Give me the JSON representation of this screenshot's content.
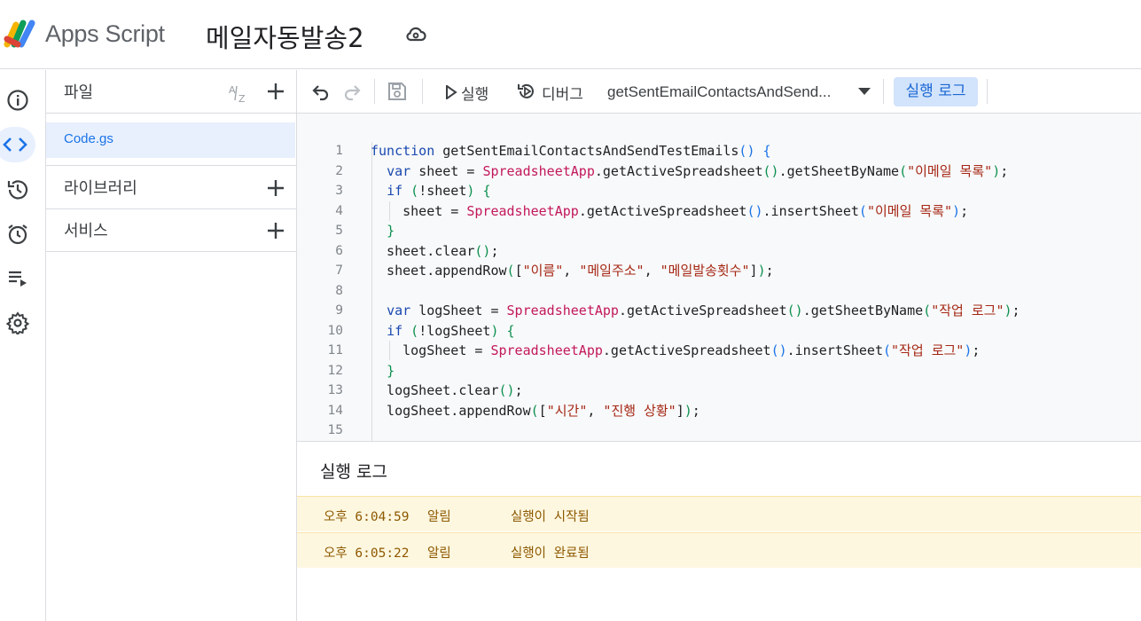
{
  "header": {
    "app_name": "Apps Script",
    "project_title": "메일자동발송2"
  },
  "rail": {
    "icons": [
      "info-icon",
      "code-icon",
      "history-icon",
      "alarm-icon",
      "executions-icon",
      "settings-icon"
    ],
    "active": "code-icon"
  },
  "files_panel": {
    "title": "파일",
    "sort_icon": "sort-az-icon",
    "files": [
      "Code.gs"
    ],
    "libraries_label": "라이브러리",
    "services_label": "서비스"
  },
  "toolbar": {
    "run_label": "실행",
    "debug_label": "디버그",
    "function_name": "getSentEmailContactsAndSend...",
    "log_button_label": "실행 로그"
  },
  "editor": {
    "lines": [
      [
        {
          "t": "function ",
          "c": "kw"
        },
        {
          "t": "getSentEmailContactsAndSendTestEmails"
        },
        {
          "t": "()",
          "c": "p1"
        },
        {
          "t": " "
        },
        {
          "t": "{",
          "c": "p1"
        }
      ],
      [
        {
          "t": "  "
        },
        {
          "t": "var ",
          "c": "kw"
        },
        {
          "t": "sheet = "
        },
        {
          "t": "SpreadsheetApp",
          "c": "cls"
        },
        {
          "t": "."
        },
        {
          "t": "getActiveSpreadsheet"
        },
        {
          "t": "()",
          "c": "p2"
        },
        {
          "t": ".getSheetByName"
        },
        {
          "t": "(",
          "c": "p2"
        },
        {
          "t": "\"이메일 목록\"",
          "c": "str"
        },
        {
          "t": ")",
          "c": "p2"
        },
        {
          "t": ";"
        }
      ],
      [
        {
          "t": "  "
        },
        {
          "t": "if ",
          "c": "kw"
        },
        {
          "t": "(",
          "c": "p2"
        },
        {
          "t": "!sheet"
        },
        {
          "t": ")",
          "c": "p2"
        },
        {
          "t": " "
        },
        {
          "t": "{",
          "c": "p2"
        }
      ],
      [
        {
          "t": "    sheet = "
        },
        {
          "t": "SpreadsheetApp",
          "c": "cls"
        },
        {
          "t": ".getActiveSpreadsheet"
        },
        {
          "t": "()",
          "c": "p1"
        },
        {
          "t": ".insertSheet"
        },
        {
          "t": "(",
          "c": "p1"
        },
        {
          "t": "\"이메일 목록\"",
          "c": "str"
        },
        {
          "t": ")",
          "c": "p1"
        },
        {
          "t": ";"
        }
      ],
      [
        {
          "t": "  "
        },
        {
          "t": "}",
          "c": "p2"
        }
      ],
      [
        {
          "t": "  sheet.clear"
        },
        {
          "t": "()",
          "c": "p2"
        },
        {
          "t": ";"
        }
      ],
      [
        {
          "t": "  sheet.appendRow"
        },
        {
          "t": "(",
          "c": "p2"
        },
        {
          "t": "["
        },
        {
          "t": "\"이름\"",
          "c": "str"
        },
        {
          "t": ", "
        },
        {
          "t": "\"메일주소\"",
          "c": "str"
        },
        {
          "t": ", "
        },
        {
          "t": "\"메일발송횟수\"",
          "c": "str"
        },
        {
          "t": "]"
        },
        {
          "t": ")",
          "c": "p2"
        },
        {
          "t": ";"
        }
      ],
      [],
      [
        {
          "t": "  "
        },
        {
          "t": "var ",
          "c": "kw"
        },
        {
          "t": "logSheet = "
        },
        {
          "t": "SpreadsheetApp",
          "c": "cls"
        },
        {
          "t": ".getActiveSpreadsheet"
        },
        {
          "t": "()",
          "c": "p2"
        },
        {
          "t": ".getSheetByName"
        },
        {
          "t": "(",
          "c": "p2"
        },
        {
          "t": "\"작업 로그\"",
          "c": "str"
        },
        {
          "t": ")",
          "c": "p2"
        },
        {
          "t": ";"
        }
      ],
      [
        {
          "t": "  "
        },
        {
          "t": "if ",
          "c": "kw"
        },
        {
          "t": "(",
          "c": "p2"
        },
        {
          "t": "!logSheet"
        },
        {
          "t": ")",
          "c": "p2"
        },
        {
          "t": " "
        },
        {
          "t": "{",
          "c": "p2"
        }
      ],
      [
        {
          "t": "    logSheet = "
        },
        {
          "t": "SpreadsheetApp",
          "c": "cls"
        },
        {
          "t": ".getActiveSpreadsheet"
        },
        {
          "t": "()",
          "c": "p1"
        },
        {
          "t": ".insertSheet"
        },
        {
          "t": "(",
          "c": "p1"
        },
        {
          "t": "\"작업 로그\"",
          "c": "str"
        },
        {
          "t": ")",
          "c": "p1"
        },
        {
          "t": ";"
        }
      ],
      [
        {
          "t": "  "
        },
        {
          "t": "}",
          "c": "p2"
        }
      ],
      [
        {
          "t": "  logSheet.clear"
        },
        {
          "t": "()",
          "c": "p2"
        },
        {
          "t": ";"
        }
      ],
      [
        {
          "t": "  logSheet.appendRow"
        },
        {
          "t": "(",
          "c": "p2"
        },
        {
          "t": "["
        },
        {
          "t": "\"시간\"",
          "c": "str"
        },
        {
          "t": ", "
        },
        {
          "t": "\"진행 상황\"",
          "c": "str"
        },
        {
          "t": "]"
        },
        {
          "t": ")",
          "c": "p2"
        },
        {
          "t": ";"
        }
      ],
      []
    ]
  },
  "log_panel": {
    "title": "실행 로그",
    "entries": [
      {
        "time": "오후 6:04:59",
        "level": "알림",
        "message": "실행이 시작됨"
      },
      {
        "time": "오후 6:05:22",
        "level": "알림",
        "message": "실행이 완료됨"
      }
    ]
  },
  "colors": {
    "accent": "#1a73e8",
    "selected_bg": "#e8f0fe",
    "log_bg": "#fef7e0",
    "keyword": "#1a49b0",
    "class": "#c2185b",
    "string": "#a52714"
  }
}
